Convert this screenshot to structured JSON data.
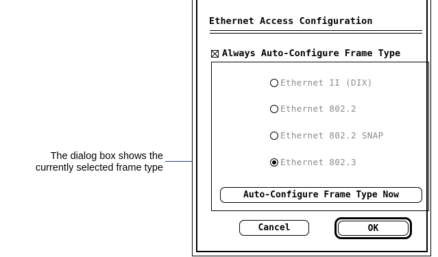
{
  "callout": {
    "line1": "The dialog box shows the",
    "line2": "currently selected frame type"
  },
  "dialog": {
    "title": "Ethernet Access Configuration",
    "auto_configure_checkbox": {
      "label": "Always Auto-Configure Frame Type",
      "checked": true
    },
    "frame_types": [
      {
        "label": "Ethernet II (DIX)",
        "selected": false,
        "enabled": false
      },
      {
        "label": "Ethernet 802.2",
        "selected": false,
        "enabled": false
      },
      {
        "label": "Ethernet 802.2 SNAP",
        "selected": false,
        "enabled": false
      },
      {
        "label": "Ethernet 802.3",
        "selected": true,
        "enabled": false
      }
    ],
    "auto_configure_now_button": "Auto-Configure Frame Type Now",
    "cancel_button": "Cancel",
    "ok_button": "OK"
  },
  "colors": {
    "leader_line": "#2d3c8c",
    "disabled_text": "#8a8a8a"
  }
}
